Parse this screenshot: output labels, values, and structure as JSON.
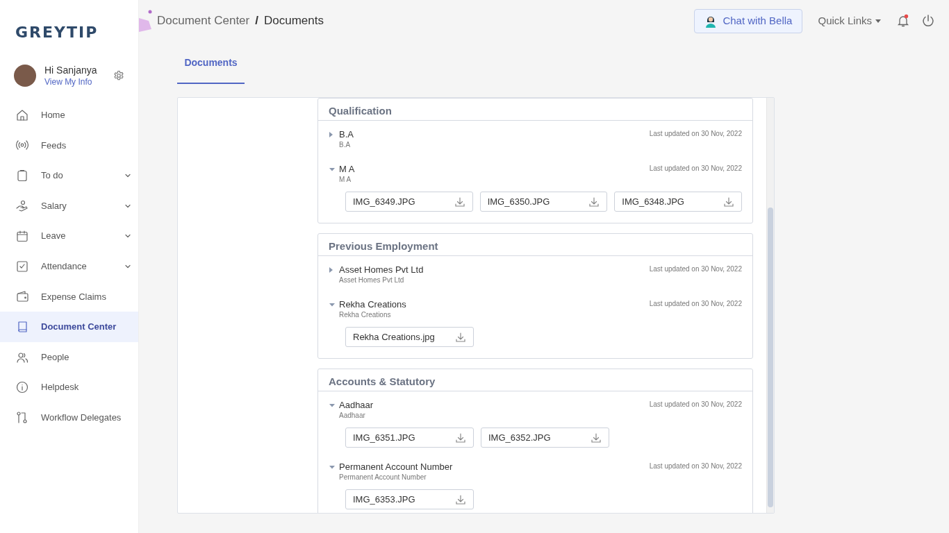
{
  "logo": {
    "text": "GREYTIP"
  },
  "user": {
    "greeting": "Hi Sanjanya",
    "link": "View My Info"
  },
  "sidebar": {
    "items": [
      {
        "label": "Home",
        "has_submenu": false,
        "selected": false
      },
      {
        "label": "Feeds",
        "has_submenu": false,
        "selected": false
      },
      {
        "label": "To do",
        "has_submenu": true,
        "selected": false
      },
      {
        "label": "Salary",
        "has_submenu": true,
        "selected": false
      },
      {
        "label": "Leave",
        "has_submenu": true,
        "selected": false
      },
      {
        "label": "Attendance",
        "has_submenu": true,
        "selected": false
      },
      {
        "label": "Expense Claims",
        "has_submenu": false,
        "selected": false
      },
      {
        "label": "Document Center",
        "has_submenu": false,
        "selected": true
      },
      {
        "label": "People",
        "has_submenu": false,
        "selected": false
      },
      {
        "label": "Helpdesk",
        "has_submenu": false,
        "selected": false
      },
      {
        "label": "Workflow Delegates",
        "has_submenu": false,
        "selected": false
      }
    ]
  },
  "breadcrumb": {
    "parent": "Document Center",
    "separator": "/",
    "current": "Documents"
  },
  "header": {
    "chat_button": "Chat with Bella",
    "quick_links": "Quick Links",
    "has_notification": true
  },
  "tabs": [
    {
      "label": "Documents",
      "selected": true
    }
  ],
  "sections": [
    {
      "title": "Qualification",
      "entries": [
        {
          "title": "B.A",
          "subtitle": "B.A",
          "updated": "Last updated on 30 Nov, 2022",
          "expanded": false
        },
        {
          "title": "M A",
          "subtitle": "M A",
          "updated": "Last updated on 30 Nov, 2022",
          "expanded": true,
          "files": [
            "IMG_6349.JPG",
            "IMG_6350.JPG",
            "IMG_6348.JPG"
          ]
        }
      ]
    },
    {
      "title": "Previous Employment",
      "entries": [
        {
          "title": "Asset Homes Pvt Ltd",
          "subtitle": "Asset Homes Pvt Ltd",
          "updated": "Last updated on 30 Nov, 2022",
          "expanded": false
        },
        {
          "title": "Rekha Creations",
          "subtitle": "Rekha Creations",
          "updated": "Last updated on 30 Nov, 2022",
          "expanded": true,
          "files": [
            "Rekha Creations.jpg"
          ]
        }
      ]
    },
    {
      "title": "Accounts & Statutory",
      "entries": [
        {
          "title": "Aadhaar",
          "subtitle": "Aadhaar",
          "updated": "Last updated on 30 Nov, 2022",
          "expanded": true,
          "files": [
            "IMG_6351.JPG",
            "IMG_6352.JPG"
          ]
        },
        {
          "title": "Permanent Account Number",
          "subtitle": "Permanent Account Number",
          "updated": "Last updated on 30 Nov, 2022",
          "expanded": true,
          "files": [
            "IMG_6353.JPG"
          ]
        }
      ]
    }
  ]
}
